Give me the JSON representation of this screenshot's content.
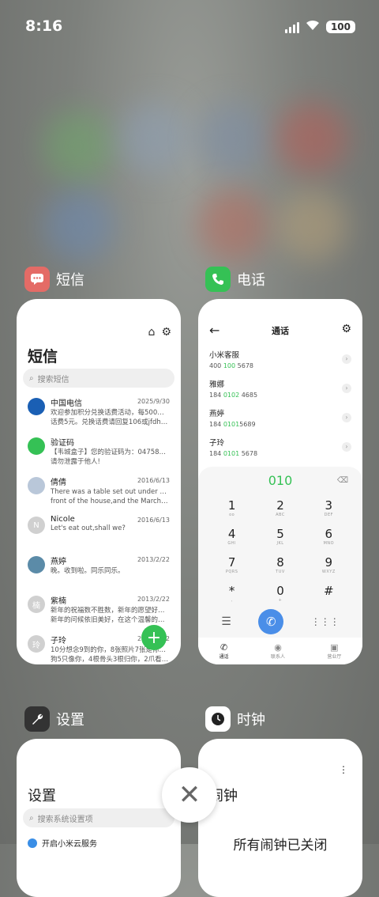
{
  "status": {
    "time": "8:16",
    "battery": "100"
  },
  "apps": {
    "sms": {
      "label": "短信",
      "title": "短信",
      "search_placeholder": "搜索短信",
      "messages": [
        {
          "name": "中国电信",
          "date": "2025/9/30",
          "line1": "欢迎参加积分兑换话费活动，每500分可兑换",
          "line2": "话费5元。兑换话费请回复106或jfdh#话费...",
          "avatar_color": "#1a5fb4",
          "avatar_text": ""
        },
        {
          "name": "验证码",
          "date": "",
          "line1": "【韦城盒子】您的验证码为：047588，",
          "line2": "请勿泄露于他人!",
          "avatar_color": "#35c155",
          "avatar_text": ""
        },
        {
          "name": "倩倩",
          "date": "2016/6/13",
          "line1": "There was a table set out under a tree in",
          "line2": "front of the house,and the March Hare an...",
          "avatar_color": "#b9c7d9",
          "avatar_text": ""
        },
        {
          "name": "Nicole",
          "date": "2016/6/13",
          "line1": "Let's eat out,shall we?",
          "line2": "",
          "avatar_color": "#d0d0d0",
          "avatar_text": "N"
        },
        {
          "name": "燕婷",
          "date": "2013/2/22",
          "line1": "晚。收到啦。同乐同乐。",
          "line2": "",
          "avatar_color": "#5b8ba8",
          "avatar_text": ""
        },
        {
          "name": "紫楠",
          "date": "2013/2/22",
          "line1": "新年的祝福数不胜数，新年的愿望好多好多，",
          "line2": "新年的问候依旧美好，在这个温馨的时刻，...",
          "avatar_color": "#d0d0d0",
          "avatar_text": "楠"
        },
        {
          "name": "子玲",
          "date": "2013/2/22",
          "line1": "10分想念9到的你，8张照片7张是你，6只小",
          "line2": "狗5只像你，4根骨头3根归你，2爪看到你...",
          "avatar_color": "#d0d0d0",
          "avatar_text": "玲"
        }
      ],
      "fab": "+"
    },
    "phone": {
      "label": "电话",
      "title": "通话",
      "contacts": [
        {
          "name": "小米客服",
          "pre": "400 ",
          "hl": "100",
          "post": " 5678"
        },
        {
          "name": "雅娜",
          "pre": "184 ",
          "hl": "0102",
          "post": " 4685"
        },
        {
          "name": "燕婷",
          "pre": "184 ",
          "hl": "0101",
          "post": "5689"
        },
        {
          "name": "子玲",
          "pre": "184 ",
          "hl": "0101",
          "post": " 5678"
        }
      ],
      "typed": "010",
      "keys": [
        {
          "d": "1",
          "l": "oo"
        },
        {
          "d": "2",
          "l": "ABC"
        },
        {
          "d": "3",
          "l": "DEF"
        },
        {
          "d": "4",
          "l": "GHI"
        },
        {
          "d": "5",
          "l": "JKL"
        },
        {
          "d": "6",
          "l": "MNO"
        },
        {
          "d": "7",
          "l": "PQRS"
        },
        {
          "d": "8",
          "l": "TUV"
        },
        {
          "d": "9",
          "l": "WXYZ"
        },
        {
          "d": "*",
          "l": ","
        },
        {
          "d": "0",
          "l": "+"
        },
        {
          "d": "#",
          "l": ""
        }
      ],
      "tabs": [
        "通话",
        "联系人",
        "营业厅"
      ]
    },
    "settings": {
      "label": "设置",
      "title": "设置",
      "search_placeholder": "搜索系统设置项",
      "row1": "开启小米云服务"
    },
    "clock": {
      "label": "时钟",
      "title": "闹钟",
      "message": "所有闹钟已关闭"
    }
  },
  "close_button": "✕"
}
